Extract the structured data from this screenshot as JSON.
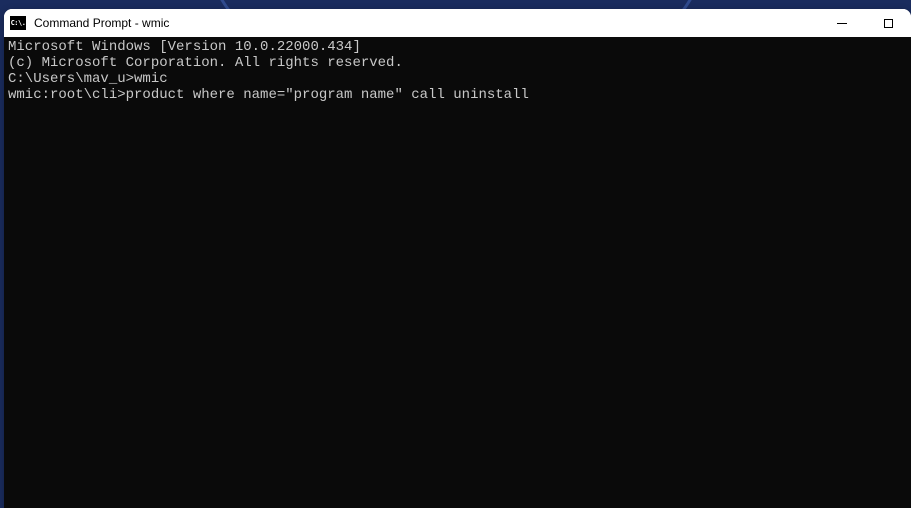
{
  "window": {
    "title": "Command Prompt - wmic",
    "icon_label": "C:\\."
  },
  "terminal": {
    "lines": [
      "Microsoft Windows [Version 10.0.22000.434]",
      "(c) Microsoft Corporation. All rights reserved.",
      "",
      "C:\\Users\\mav_u>wmic",
      "wmic:root\\cli>product where name=\"program name\" call uninstall"
    ]
  }
}
